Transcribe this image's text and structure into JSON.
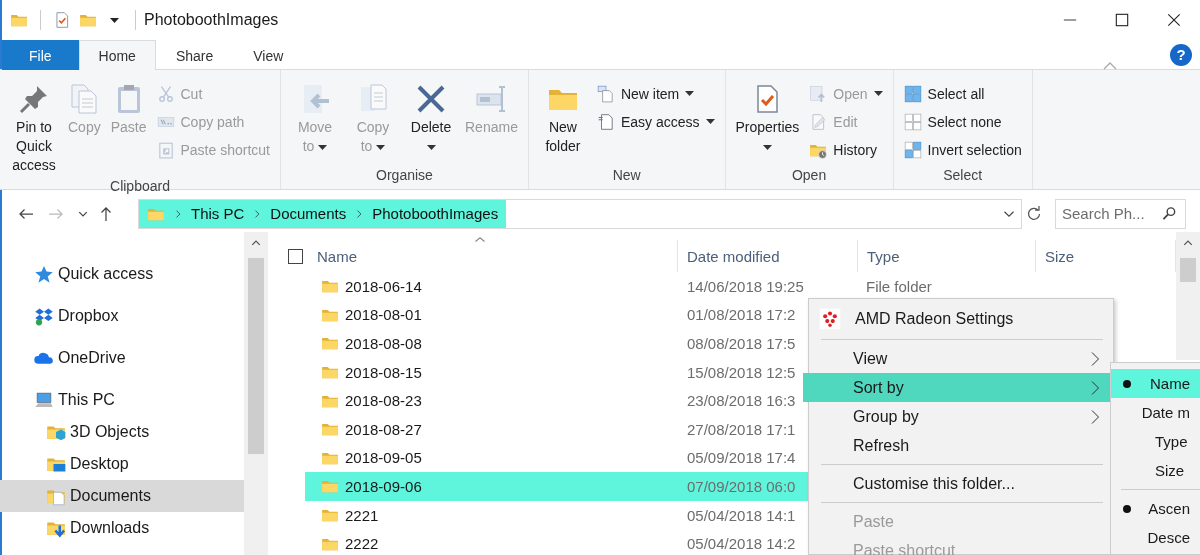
{
  "window": {
    "title": "PhotoboothImages",
    "help": "?"
  },
  "tabs": [
    {
      "label": "File",
      "kind": "file",
      "selected": false
    },
    {
      "label": "Home",
      "kind": "tab",
      "selected": true
    },
    {
      "label": "Share",
      "kind": "tab",
      "selected": false
    },
    {
      "label": "View",
      "kind": "tab",
      "selected": false
    }
  ],
  "ribbon": {
    "groups": [
      {
        "label": "Clipboard",
        "buttons": [
          {
            "label": "Pin to Quick access",
            "kind": "large",
            "disabled": false
          },
          {
            "label": "Copy",
            "kind": "large",
            "disabled": true
          },
          {
            "label": "Paste",
            "kind": "large",
            "disabled": true
          },
          {
            "label": "Cut",
            "kind": "small",
            "disabled": true
          },
          {
            "label": "Copy path",
            "kind": "small",
            "disabled": true
          },
          {
            "label": "Paste shortcut",
            "kind": "small",
            "disabled": true
          }
        ]
      },
      {
        "label": "Organise",
        "buttons": [
          {
            "label": "Move to",
            "kind": "large",
            "disabled": true,
            "dropdown": true
          },
          {
            "label": "Copy to",
            "kind": "large",
            "disabled": true,
            "dropdown": true
          },
          {
            "label": "Delete",
            "kind": "large",
            "disabled": false,
            "dropdown": true
          },
          {
            "label": "Rename",
            "kind": "large",
            "disabled": true
          }
        ]
      },
      {
        "label": "New",
        "buttons": [
          {
            "label": "New folder",
            "kind": "large",
            "disabled": false
          },
          {
            "label": "New item",
            "kind": "small",
            "disabled": false,
            "dropdown": true
          },
          {
            "label": "Easy access",
            "kind": "small",
            "disabled": false,
            "dropdown": true
          }
        ]
      },
      {
        "label": "Open",
        "buttons": [
          {
            "label": "Properties",
            "kind": "large",
            "disabled": false,
            "dropdown": true
          },
          {
            "label": "Open",
            "kind": "small",
            "disabled": true,
            "dropdown": true
          },
          {
            "label": "Edit",
            "kind": "small",
            "disabled": true
          },
          {
            "label": "History",
            "kind": "small",
            "disabled": false
          }
        ]
      },
      {
        "label": "Select",
        "buttons": [
          {
            "label": "Select all",
            "kind": "small",
            "disabled": false
          },
          {
            "label": "Select none",
            "kind": "small",
            "disabled": false
          },
          {
            "label": "Invert selection",
            "kind": "small",
            "disabled": false
          }
        ]
      }
    ]
  },
  "address_bar": {
    "crumbs": [
      "This PC",
      "Documents",
      "PhotoboothImages"
    ],
    "highlighted": true
  },
  "search": {
    "placeholder": "Search Ph..."
  },
  "navigation": {
    "items": [
      {
        "label": "Quick access",
        "selected": false
      },
      {
        "label": "Dropbox",
        "selected": false
      },
      {
        "label": "OneDrive",
        "selected": false
      },
      {
        "label": "This PC",
        "selected": false,
        "children": [
          {
            "label": "3D Objects",
            "selected": false
          },
          {
            "label": "Desktop",
            "selected": false
          },
          {
            "label": "Documents",
            "selected": true
          },
          {
            "label": "Downloads",
            "selected": false
          }
        ]
      }
    ]
  },
  "file_list": {
    "select_all": {
      "checked": false
    },
    "columns": [
      "Name",
      "Date modified",
      "Type",
      "Size"
    ],
    "rows": [
      {
        "name": "2018-06-14",
        "date_modified": "14/06/2018 19:25",
        "type": "File folder",
        "selected": false
      },
      {
        "name": "2018-08-01",
        "date_modified": "01/08/2018 17:2",
        "selected": false
      },
      {
        "name": "2018-08-08",
        "date_modified": "08/08/2018 17:5",
        "selected": false
      },
      {
        "name": "2018-08-15",
        "date_modified": "15/08/2018 12:5",
        "selected": false
      },
      {
        "name": "2018-08-23",
        "date_modified": "23/08/2018 16:3",
        "selected": false
      },
      {
        "name": "2018-08-27",
        "date_modified": "27/08/2018 17:1",
        "selected": false
      },
      {
        "name": "2018-09-05",
        "date_modified": "05/09/2018 17:4",
        "selected": false
      },
      {
        "name": "2018-09-06",
        "date_modified": "07/09/2018 06:0",
        "selected": true
      },
      {
        "name": "2221",
        "date_modified": "05/04/2018 14:1",
        "selected": false
      },
      {
        "name": "2222",
        "date_modified": "05/04/2018 14:2",
        "selected": false
      }
    ]
  },
  "context_menu": {
    "items": [
      {
        "kind": "app",
        "label": "AMD Radeon Settings"
      },
      {
        "kind": "separator"
      },
      {
        "kind": "item",
        "label": "View",
        "submenu": true,
        "selected": false,
        "disabled": false
      },
      {
        "kind": "item",
        "label": "Sort by",
        "submenu": true,
        "selected": true,
        "disabled": false
      },
      {
        "kind": "item",
        "label": "Group by",
        "submenu": true,
        "selected": false,
        "disabled": false
      },
      {
        "kind": "item",
        "label": "Refresh",
        "submenu": false,
        "selected": false,
        "disabled": false
      },
      {
        "kind": "separator"
      },
      {
        "kind": "item",
        "label": "Customise this folder...",
        "submenu": false,
        "selected": false,
        "disabled": false
      },
      {
        "kind": "separator"
      },
      {
        "kind": "item",
        "label": "Paste",
        "submenu": false,
        "selected": false,
        "disabled": true
      },
      {
        "kind": "item",
        "label": "Paste shortcut",
        "submenu": false,
        "selected": false,
        "disabled": true
      }
    ]
  },
  "sort_submenu": {
    "items": [
      {
        "kind": "item",
        "label": "Name",
        "checked": true,
        "selected": true
      },
      {
        "kind": "item",
        "label": "Date m",
        "checked": false,
        "selected": false
      },
      {
        "kind": "item",
        "label": "Type",
        "checked": false,
        "selected": false
      },
      {
        "kind": "item",
        "label": "Size",
        "checked": false,
        "selected": false
      },
      {
        "kind": "separator"
      },
      {
        "kind": "item",
        "label": "Ascen",
        "checked": true,
        "selected": false
      },
      {
        "kind": "item",
        "label": "Desce",
        "checked": false,
        "selected": false
      }
    ]
  }
}
